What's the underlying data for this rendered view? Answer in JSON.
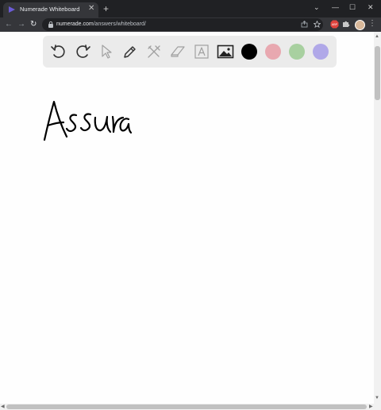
{
  "browser": {
    "tab_title": "Numerade Whiteboard",
    "tab_close": "✕",
    "new_tab": "+",
    "window_controls": {
      "minimize": "—",
      "maximize": "☐",
      "close": "✕",
      "dropdown": "⌄"
    },
    "nav": {
      "back": "←",
      "forward": "→",
      "reload": "↻"
    },
    "url_host": "numerade.com",
    "url_path": "/answers/whiteboard/",
    "extension_badge": "ABP",
    "menu": "⋮"
  },
  "whiteboard": {
    "tools": [
      "undo-icon",
      "redo-icon",
      "pointer-icon",
      "pen-icon",
      "tools-icon",
      "eraser-icon",
      "text-icon",
      "image-icon"
    ],
    "colors": [
      "#000000",
      "#e8a8b0",
      "#a8d0a0",
      "#b0a8e8"
    ],
    "selected_color": "#000000"
  }
}
